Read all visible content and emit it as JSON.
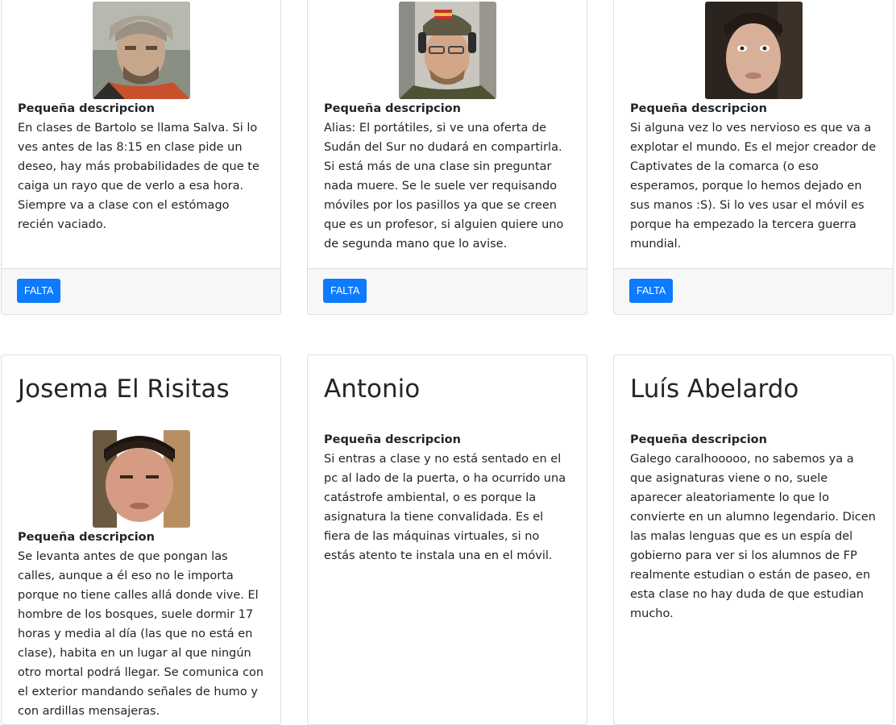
{
  "cards": [
    {
      "name": "",
      "label": "Pequeña descripcion",
      "description": "En clases de Bartolo se llama Salva. Si lo ves antes de las 8:15 en clase pide un deseo, hay más probabilidades de que te caiga un rayo que de verlo a esa hora. Siempre va a clase con el estómago recién vaciado.",
      "button": "FALTA"
    },
    {
      "name": "",
      "label": "Pequeña descripcion",
      "description": "Alias: El portátiles, si ve una oferta de Sudán del Sur no dudará en compartirla. Si está más de una clase sin preguntar nada muere. Se le suele ver requisando móviles por los pasillos ya que se creen que es un profesor, si alguien quiere uno de segunda mano que lo avise.",
      "button": "FALTA"
    },
    {
      "name": "",
      "label": "Pequeña descripcion",
      "description": "Si alguna vez lo ves nervioso es que va a explotar el mundo. Es el mejor creador de Captivates de la comarca (o eso esperamos, porque lo hemos dejado en sus manos :S). Si lo ves usar el móvil es porque ha empezado la tercera guerra mundial.",
      "button": "FALTA"
    },
    {
      "name": "Josema El Risitas",
      "label": "Pequeña descripcion",
      "description": "Se levanta antes de que pongan las calles, aunque a él eso no le importa porque no tiene calles allá donde vive. El hombre de los bosques, suele dormir 17 horas y media al día (las que no está en clase), habita en un lugar al que ningún otro mortal podrá llegar. Se comunica con el exterior mandando señales de humo y con ardillas mensajeras."
    },
    {
      "name": "Antonio",
      "label": "Pequeña descripcion",
      "description": "Si entras a clase y no está sentado en el pc al lado de la puerta, o ha ocurrido una catástrofe ambiental, o es porque la asignatura la tiene convalidada. Es el fiera de las máquinas virtuales, si no estás atento te instala una en el móvil."
    },
    {
      "name": "Luís Abelardo",
      "label": "Pequeña descripcion",
      "description": "Galego caralhooooo, no sabemos ya a que asignaturas viene o no, suele aparecer aleatoriamente lo que lo convierte en un alumno legendario. Dicen las malas lenguas que es un espía del gobierno para ver si los alumnos de FP realmente estudian o están de paseo, en esta clase no hay duda de que estudian mucho."
    }
  ],
  "colors": {
    "button": "#0d7bfe",
    "footer": "#f7f7f7",
    "border": "#dfdfdf"
  }
}
